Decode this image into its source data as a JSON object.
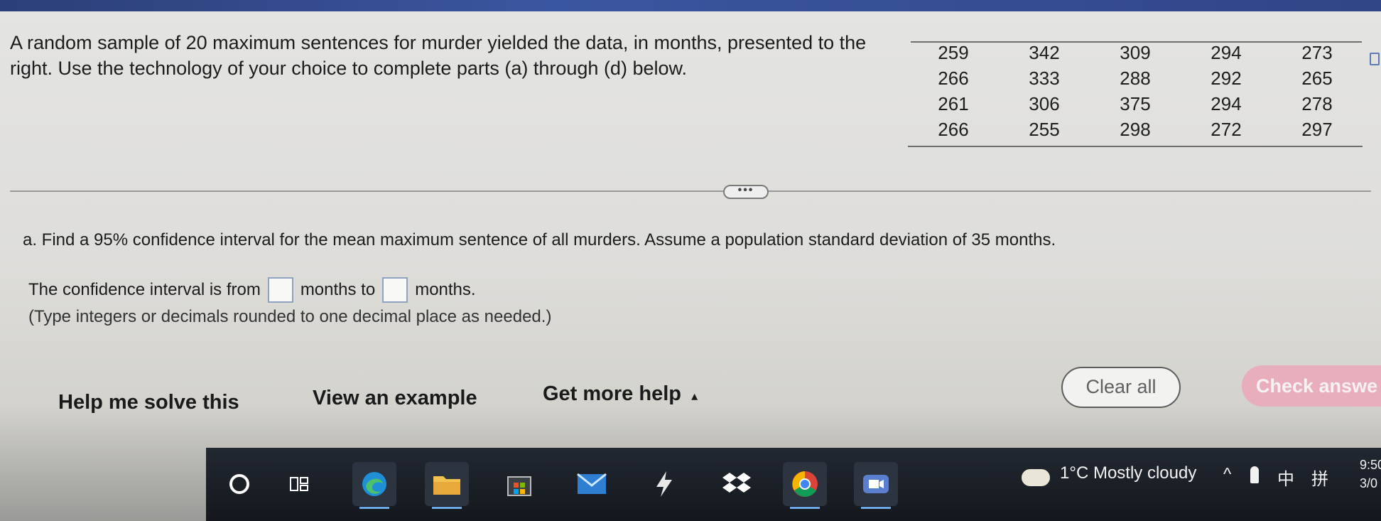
{
  "problem": {
    "intro": "A random sample of 20 maximum sentences for murder yielded the data, in months, presented to the right. Use the technology of your choice to complete parts (a) through (d) below."
  },
  "data_table": {
    "rows": [
      [
        "259",
        "342",
        "309",
        "294",
        "273"
      ],
      [
        "266",
        "333",
        "288",
        "292",
        "265"
      ],
      [
        "261",
        "306",
        "375",
        "294",
        "278"
      ],
      [
        "266",
        "255",
        "298",
        "272",
        "297"
      ]
    ]
  },
  "expand_button": {
    "label": "•••"
  },
  "question_a": {
    "text": "a. Find a 95% confidence interval for the mean maximum sentence of all murders. Assume a population standard deviation of 35 months.",
    "answer_prefix": "The confidence interval is from",
    "answer_middle": "months to",
    "answer_suffix": "months.",
    "hint": "(Type integers or decimals rounded to one decimal place as needed.)",
    "lower_value": "",
    "upper_value": ""
  },
  "actions": {
    "help_me_solve": "Help me solve this",
    "view_example": "View an example",
    "get_more_help": "Get more help",
    "get_more_help_arrow": "▴",
    "clear_all": "Clear all",
    "check_answer": "Check answe"
  },
  "taskbar": {
    "icons": [
      "start-icon",
      "task-view-icon",
      "edge-icon",
      "file-explorer-icon",
      "store-icon",
      "mail-icon",
      "app-icon",
      "dropbox-icon",
      "chrome-icon",
      "video-app-icon"
    ],
    "weather": "1°C  Mostly cloudy",
    "tray_chevron": "^",
    "tray_ime": "中",
    "tray_keyboard": "拼",
    "clock_time": "9:50",
    "clock_date": "3/0"
  },
  "colors": {
    "check_answer_bg": "#e8aebb",
    "taskbar_bg": "#14181e",
    "answer_box_border": "#8fa2bf"
  }
}
